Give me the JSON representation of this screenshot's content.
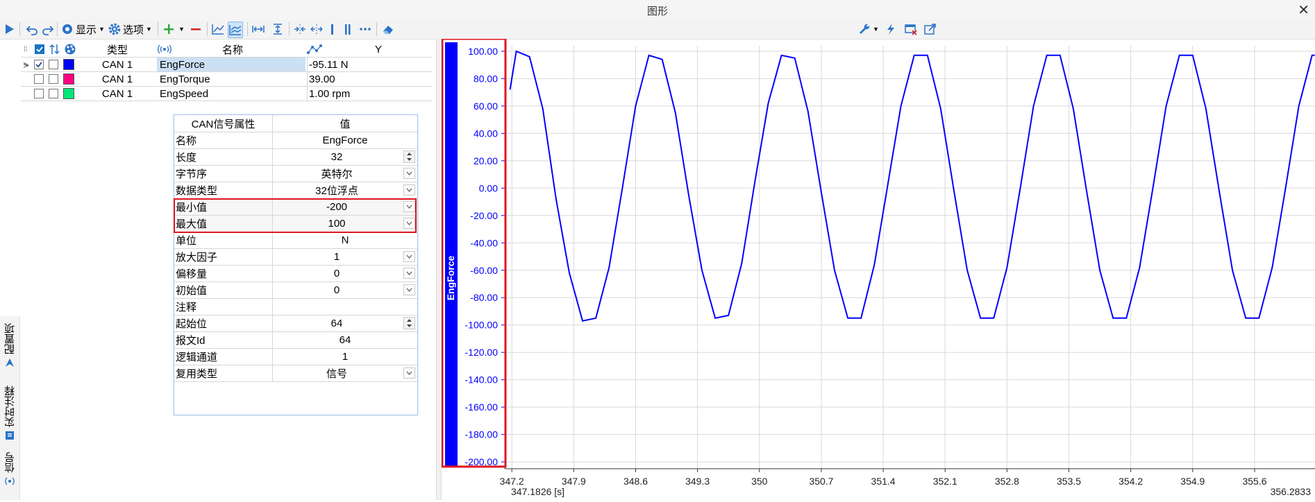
{
  "window": {
    "title": "图形",
    "close_glyph": "✕"
  },
  "toolbar": {
    "display_label": "显示",
    "options_label": "选项",
    "icons": [
      "play-icon",
      "undo-icon",
      "redo-icon",
      "display-icon",
      "gear-icon",
      "add-icon",
      "remove-icon",
      "line-chart-icon",
      "multi-line-icon",
      "fit-x-icon",
      "fit-y-icon",
      "compress-icon",
      "expand-icon",
      "cursor-single-icon",
      "cursor-double-icon",
      "more-icon",
      "eraser-icon",
      "wrench-icon",
      "lightning-icon",
      "window-close-icon",
      "export-icon"
    ]
  },
  "signal_table": {
    "headers": {
      "type": "类型",
      "name": "名称",
      "y": "Y"
    },
    "rows": [
      {
        "type": "CAN 1",
        "name": "EngForce",
        "y": "-95.11 N",
        "color": "#0000ff",
        "checked": true,
        "selected": true
      },
      {
        "type": "CAN 1",
        "name": "EngTorque",
        "y": "39.00",
        "color": "#ff0080",
        "checked": false,
        "selected": false
      },
      {
        "type": "CAN 1",
        "name": "EngSpeed",
        "y": "1.00 rpm",
        "color": "#00e676",
        "checked": false,
        "selected": false
      }
    ]
  },
  "properties": {
    "header_name": "CAN信号属性",
    "header_value": "值",
    "rows": [
      {
        "name": "名称",
        "value": "EngForce",
        "ctl": "none"
      },
      {
        "name": "长度",
        "value": "32",
        "ctl": "spin"
      },
      {
        "name": "字节序",
        "value": "英特尔",
        "ctl": "drop"
      },
      {
        "name": "数据类型",
        "value": "32位浮点",
        "ctl": "drop"
      },
      {
        "name": "最小值",
        "value": "-200",
        "ctl": "drop"
      },
      {
        "name": "最大值",
        "value": "100",
        "ctl": "drop"
      },
      {
        "name": "单位",
        "value": "N",
        "ctl": "none"
      },
      {
        "name": "放大因子",
        "value": "1",
        "ctl": "drop"
      },
      {
        "name": "偏移量",
        "value": "0",
        "ctl": "drop"
      },
      {
        "name": "初始值",
        "value": "0",
        "ctl": "drop"
      },
      {
        "name": "注释",
        "value": "",
        "ctl": "none"
      },
      {
        "name": "起始位",
        "value": "64",
        "ctl": "spin"
      },
      {
        "name": "报文Id",
        "value": "64",
        "ctl": "none"
      },
      {
        "name": "逻辑通道",
        "value": "1",
        "ctl": "none"
      },
      {
        "name": "复用类型",
        "value": "信号",
        "ctl": "drop"
      }
    ]
  },
  "side_tabs": [
    "配置项",
    "实时注释",
    "信号"
  ],
  "chart_data": {
    "type": "line",
    "series": [
      {
        "name": "EngForce",
        "color": "#0000ff",
        "x": [
          347.18,
          347.25,
          347.4,
          347.55,
          347.7,
          347.85,
          348.0,
          348.15,
          348.3,
          348.45,
          348.6,
          348.75,
          348.9,
          349.05,
          349.2,
          349.35,
          349.5,
          349.65,
          349.8,
          349.95,
          350.1,
          350.25,
          350.4,
          350.55,
          350.7,
          350.85,
          351.0,
          351.15,
          351.3,
          351.45,
          351.6,
          351.75,
          351.9,
          352.05,
          352.2,
          352.35,
          352.5,
          352.65,
          352.8,
          352.95,
          353.1,
          353.25,
          353.4,
          353.55,
          353.7,
          353.85,
          354.0,
          354.15,
          354.3,
          354.45,
          354.6,
          354.75,
          354.9,
          355.05,
          355.2,
          355.35,
          355.5,
          355.65,
          355.8,
          355.95,
          356.1,
          356.25,
          356.28
        ],
        "y": [
          72,
          100,
          96,
          58,
          -8,
          -62,
          -97,
          -95,
          -58,
          0,
          60,
          97,
          94,
          55,
          -5,
          -60,
          -95,
          -93,
          -55,
          5,
          62,
          97,
          95,
          56,
          -3,
          -60,
          -95,
          -95,
          -56,
          2,
          60,
          97,
          97,
          58,
          -2,
          -60,
          -95,
          -95,
          -58,
          0,
          60,
          97,
          97,
          58,
          -2,
          -60,
          -95,
          -95,
          -58,
          0,
          60,
          97,
          97,
          58,
          -2,
          -60,
          -95,
          -95,
          -58,
          0,
          60,
          97,
          97
        ]
      }
    ],
    "ylabel": "EngForce",
    "ylim": [
      -205,
      104
    ],
    "xlim": [
      347.12,
      356.2833
    ],
    "yticks": [
      100,
      80,
      60,
      40,
      20,
      0,
      -20,
      -40,
      -60,
      -80,
      -100,
      -120,
      -140,
      -160,
      -180,
      -200
    ],
    "ytick_labels": [
      "100.00",
      "80.00",
      "60.00",
      "40.00",
      "20.00",
      "0.00",
      "-20.00",
      "-40.00",
      "-60.00",
      "-80.00",
      "-100.00",
      "-120.00",
      "-140.00",
      "-160.00",
      "-180.00",
      "-200.00"
    ],
    "xticks": [
      347.2,
      347.9,
      348.6,
      349.3,
      350,
      350.7,
      351.4,
      352.1,
      352.8,
      353.5,
      354.2,
      354.9,
      355.6
    ],
    "xtick_labels": [
      "347.2",
      "347.9",
      "348.6",
      "349.3",
      "350",
      "350.7",
      "351.4",
      "352.1",
      "352.8",
      "353.5",
      "354.2",
      "354.9",
      "355.6"
    ],
    "x_start_label": "347.1826 [s]",
    "x_end_label": "356.2833",
    "grid": true,
    "axis_color": "#0000ff"
  }
}
